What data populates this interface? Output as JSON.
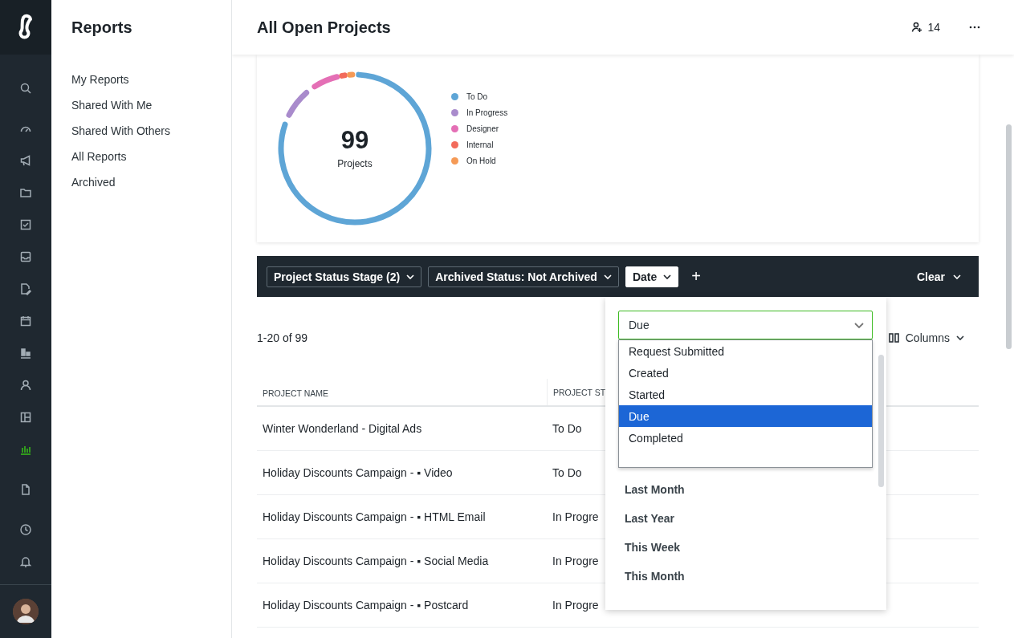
{
  "rail": {
    "items": [
      {
        "kind": "search",
        "selected": false
      },
      {
        "kind": "gauge",
        "selected": false
      },
      {
        "kind": "megaphone",
        "selected": false
      },
      {
        "kind": "folder",
        "selected": false
      },
      {
        "kind": "checkbox",
        "selected": false
      },
      {
        "kind": "inbox",
        "selected": false
      },
      {
        "kind": "file-edit",
        "selected": false
      },
      {
        "kind": "calendar",
        "selected": false
      },
      {
        "kind": "board",
        "selected": false
      },
      {
        "kind": "user",
        "selected": false
      },
      {
        "kind": "layout",
        "selected": false
      },
      {
        "kind": "chart",
        "selected": true
      },
      {
        "kind": "file",
        "selected": false
      },
      {
        "kind": "clock",
        "selected": false
      },
      {
        "kind": "bell",
        "selected": false
      }
    ]
  },
  "sidebar": {
    "title": "Reports",
    "items": [
      "My Reports",
      "Shared With Me",
      "Shared With Others",
      "All Reports",
      "Archived"
    ]
  },
  "header": {
    "title": "All Open Projects",
    "members": "14"
  },
  "summary": {
    "total": "99",
    "total_label": "Projects",
    "legend": [
      {
        "label": "To Do",
        "color": "#5ea5d6"
      },
      {
        "label": "In Progress",
        "color": "#a98bcc"
      },
      {
        "label": "Designer",
        "color": "#e46fb5"
      },
      {
        "label": "Internal",
        "color": "#f26b5b"
      },
      {
        "label": "On Hold",
        "color": "#f59a56"
      }
    ]
  },
  "filters": {
    "chips": [
      {
        "label": "Project Status Stage (2)",
        "open": false
      },
      {
        "label": "Archived Status: Not Archived",
        "open": false
      },
      {
        "label": "Date",
        "open": true
      }
    ],
    "add": "+",
    "clear": "Clear"
  },
  "table": {
    "count": "1-20 of 99",
    "columns_button": "Columns",
    "columns": [
      "PROJECT NAME",
      "PROJECT ST"
    ],
    "rows": [
      [
        "Winter Wonderland - Digital Ads",
        "To Do"
      ],
      [
        "Holiday Discounts Campaign - ▪ Video",
        "To Do"
      ],
      [
        "Holiday Discounts Campaign - ▪ HTML Email",
        "In Progre"
      ],
      [
        "Holiday Discounts Campaign - ▪ Social Media",
        "In Progre"
      ],
      [
        "Holiday Discounts Campaign - ▪ Postcard",
        "In Progre"
      ]
    ]
  },
  "date_panel": {
    "field": {
      "value": "Due"
    },
    "options": [
      {
        "label": "Request Submitted",
        "selected": false
      },
      {
        "label": "Created",
        "selected": false
      },
      {
        "label": "Started",
        "selected": false
      },
      {
        "label": "Due",
        "selected": true
      },
      {
        "label": "Completed",
        "selected": false
      }
    ],
    "ranges": [
      "Last Month",
      "Last Year",
      "This Week",
      "This Month"
    ]
  }
}
